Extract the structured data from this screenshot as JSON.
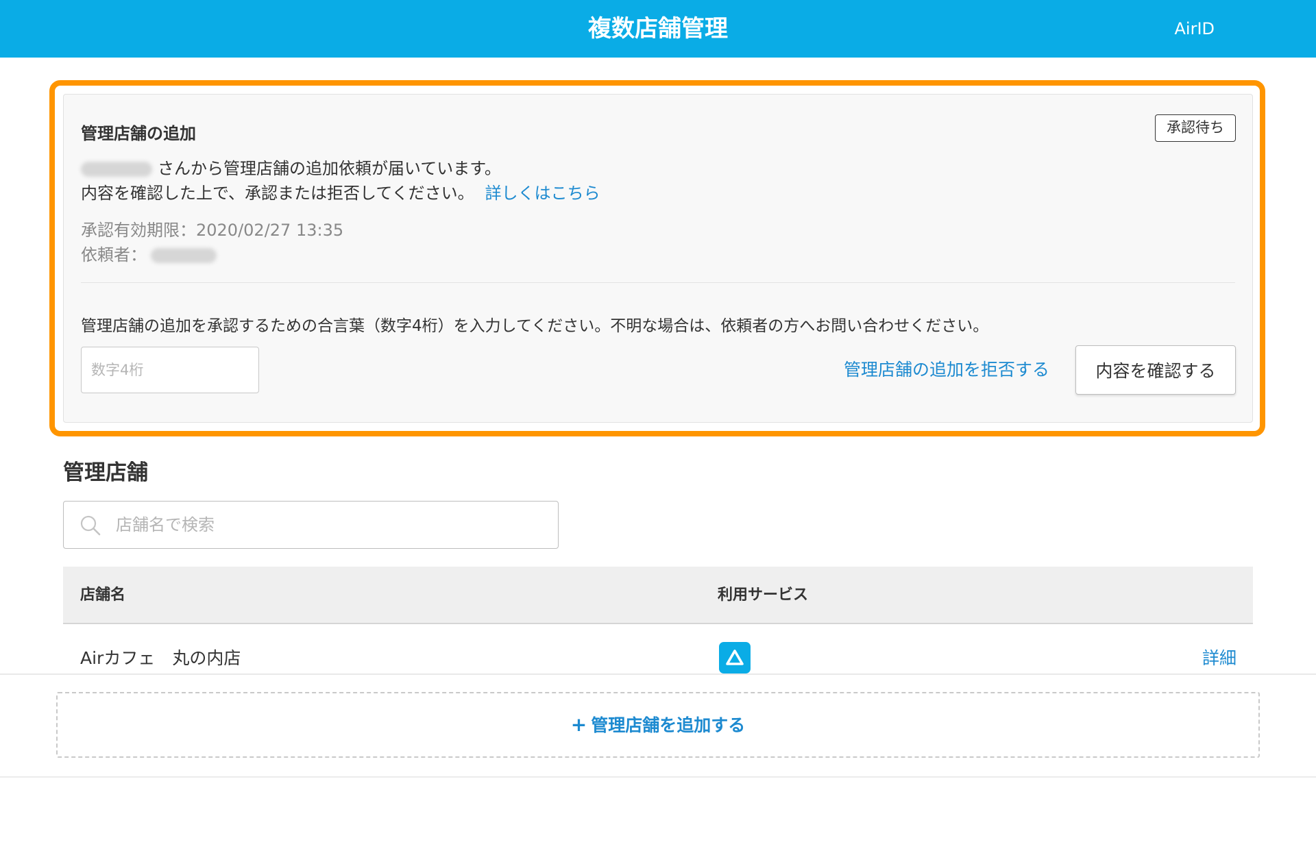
{
  "header": {
    "title": "複数店舗管理",
    "account": "AirID"
  },
  "request_card": {
    "title": "管理店舗の追加",
    "status_badge": "承認待ち",
    "message_line1": "さんから管理店舗の追加依頼が届いています。",
    "message_line2": "内容を確認した上で、承認または拒否してください。",
    "details_link": "詳しくはこちら",
    "expiry_label": "承認有効期限：",
    "expiry_value": "2020/02/27 13:35",
    "requester_label": "依頼者：",
    "instruction": "管理店舗の追加を承認するための合言葉（数字4桁）を入力してください。不明な場合は、依頼者の方へお問い合わせください。",
    "code_placeholder": "数字4桁",
    "reject_link": "管理店舗の追加を拒否する",
    "confirm_button": "内容を確認する",
    "accent_color": "#ff9500"
  },
  "stores_section": {
    "title": "管理店舗",
    "search_placeholder": "店舗名で検索",
    "columns": [
      "店舗名",
      "利用サービス"
    ],
    "rows": [
      {
        "name": "Airカフェ　丸の内店",
        "service_icon": "airregi-triangle-icon",
        "detail_link": "詳細"
      }
    ],
    "add_button": "管理店舗を追加する",
    "add_icon": "+"
  },
  "colors": {
    "header_bg": "#0aace6",
    "link": "#1d8ad0"
  }
}
